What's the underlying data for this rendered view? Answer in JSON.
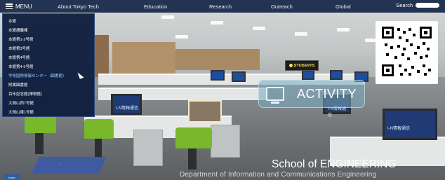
{
  "topnav": {
    "menu_label": "MENU",
    "items": [
      "About Tokyo Tech",
      "Education",
      "Research",
      "Outreach",
      "Global"
    ],
    "search_label": "Search"
  },
  "menu": {
    "items": [
      "本館",
      "本館講義棟",
      "本館第1-2号館",
      "本館第3号館",
      "本館第4号館",
      "本館第4-5号館",
      "学術国際情報センター（図書館）",
      "附属図書館",
      "百年記念館(博物館)",
      "大岡山西7号館",
      "大岡山東1号館"
    ],
    "active_index": 6
  },
  "scene": {
    "activity_label": "ACTIVITY",
    "students_sign": "STUDENTS",
    "monitor_labels": [
      "I-N情報通信",
      "I-N情報通信",
      "I-N情報通信"
    ],
    "arrow_label": "→",
    "bottom_tag": "Index"
  },
  "footer": {
    "school": "School of ENGINEERING",
    "department": "Department of Information and Communications Engineering"
  },
  "colors": {
    "nav_bg": "#122646",
    "menu_bg": "#101e3e",
    "chair_green": "#7ab82b",
    "monitor_blue": "#1f3a74"
  }
}
